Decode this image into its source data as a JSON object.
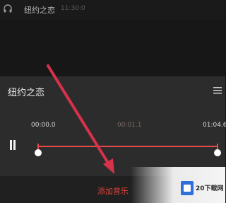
{
  "top_bar": {
    "title": "纽约之恋",
    "subtitle": "11:30:0",
    "icon": "headphones-icon"
  },
  "player": {
    "track_title": "纽约之恋",
    "list_icon": "playlist-icon",
    "time_start": "00:00.0",
    "time_middle": "00:01.1",
    "time_end": "01:04.6",
    "pause_icon": "pause-icon"
  },
  "bottom_bar": {
    "add_music_label": "添加音乐"
  },
  "watermark": {
    "text": "20下载网"
  },
  "colors": {
    "accent": "#e84a4a",
    "panel": "#2c2c2c",
    "background": "#161616",
    "annotation_arrow": "#d8324a"
  }
}
